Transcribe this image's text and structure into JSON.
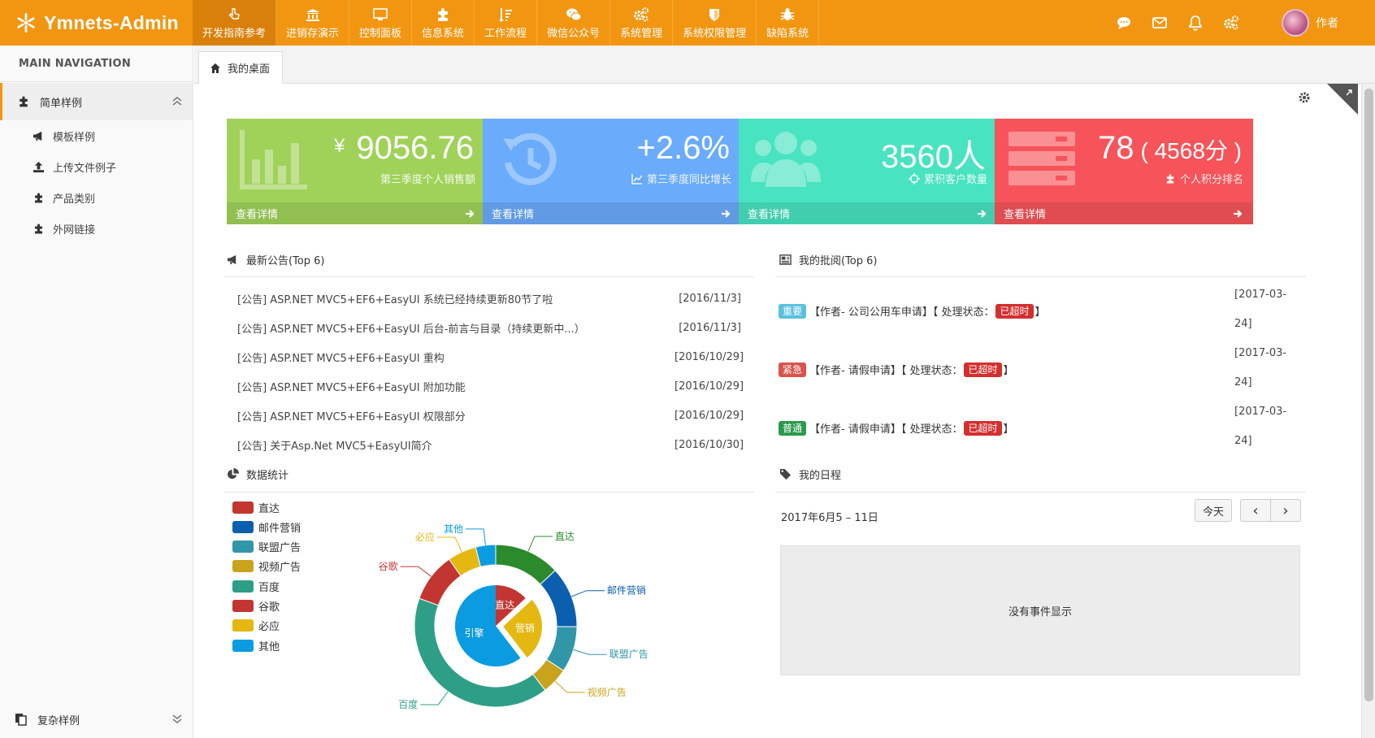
{
  "app": {
    "brand": "Ymnets-Admin",
    "user_name": "作者"
  },
  "topnav": [
    {
      "label": "开发指南参考",
      "icon": "pointer-hand-icon"
    },
    {
      "label": "进销存演示",
      "icon": "bank-icon"
    },
    {
      "label": "控制面板",
      "icon": "monitor-icon"
    },
    {
      "label": "信息系统",
      "icon": "puzzle-icon"
    },
    {
      "label": "工作流程",
      "icon": "sort-list-icon"
    },
    {
      "label": "微信公众号",
      "icon": "wechat-icon"
    },
    {
      "label": "系统管理",
      "icon": "gears-icon"
    },
    {
      "label": "系统权限管理",
      "icon": "shield-icon"
    },
    {
      "label": "缺陷系统",
      "icon": "bug-icon"
    }
  ],
  "sidebar": {
    "header": "MAIN NAVIGATION",
    "group1": "简单样例",
    "items": [
      {
        "label": "模板样例",
        "icon": "bullhorn-icon"
      },
      {
        "label": "上传文件例子",
        "icon": "upload-icon"
      },
      {
        "label": "产品类别",
        "icon": "puzzle-icon"
      },
      {
        "label": "外网链接",
        "icon": "puzzle-icon"
      }
    ],
    "group2": "复杂样例"
  },
  "tabs": {
    "home": "我的桌面"
  },
  "cards": [
    {
      "value": "9056.76",
      "prefix": "¥",
      "desc": "第三季度个人销售额",
      "foot": "查看详情",
      "color": "#a0d25a"
    },
    {
      "value": "+2.6%",
      "desc": "第三季度同比增长",
      "foot": "查看详情",
      "color": "#6aabfb"
    },
    {
      "value": "3560人",
      "desc": "累积客户数量",
      "foot": "查看详情",
      "color": "#48e3c0"
    },
    {
      "value": "78",
      "value_suffix": "( 4568分 )",
      "desc": "个人积分排名",
      "foot": "查看详情",
      "color": "#f6545a"
    }
  ],
  "announcements": {
    "title": "最新公告(Top 6)",
    "rows": [
      {
        "text": "[公告] ASP.NET MVC5+EF6+EasyUI 系统已经持续更新80节了啦",
        "date": "[2016/11/3]"
      },
      {
        "text": "[公告] ASP.NET MVC5+EF6+EasyUI 后台-前言与目录（持续更新中...）",
        "date": "[2016/11/3]"
      },
      {
        "text": "[公告] ASP.NET MVC5+EF6+EasyUI 重构",
        "date": "[2016/10/29]"
      },
      {
        "text": "[公告] ASP.NET MVC5+EF6+EasyUI 附加功能",
        "date": "[2016/10/29]"
      },
      {
        "text": "[公告] ASP.NET MVC5+EF6+EasyUI 权限部分",
        "date": "[2016/10/29]"
      },
      {
        "text": "[公告] 关于Asp.Net MVC5+EasyUI简介",
        "date": "[2016/10/30]"
      }
    ]
  },
  "approvals": {
    "title": "我的批阅(Top 6)",
    "rows": [
      {
        "badge": "重要",
        "badge_color": "#5bc0de",
        "text": "【作者- 公司公用车申请】【 处理状态：",
        "status": "已超时",
        "end": "】",
        "date1": "[2017-03-",
        "date2": "24]"
      },
      {
        "badge": "紧急",
        "badge_color": "#d9534f",
        "text": "【作者- 请假申请】【 处理状态：",
        "status": "已超时",
        "end": "】",
        "date1": "[2017-03-",
        "date2": "24]"
      },
      {
        "badge": "普通",
        "badge_color": "#2c9a4e",
        "text": "【作者- 请假申请】【 处理状态：",
        "status": "已超时",
        "end": "】",
        "date1": "[2017-03-",
        "date2": "24]"
      }
    ]
  },
  "stats": {
    "title": "数据统计"
  },
  "schedule": {
    "title": "我的日程",
    "range": "2017年6月5 – 11日",
    "today": "今天",
    "prev": "‹",
    "next": "›",
    "empty": "没有事件显示"
  },
  "chart_data": {
    "type": "pie",
    "legend_position": "left",
    "inner": {
      "labels": [
        "直达",
        "营销",
        "引擎"
      ],
      "values": [
        335,
        679,
        1548
      ],
      "colors": [
        "#c23531",
        "#e5b711",
        "#0b9be0"
      ]
    },
    "outer": {
      "labels": [
        "直达",
        "邮件营销",
        "联盟广告",
        "视频广告",
        "百度",
        "谷歌",
        "必应",
        "其他"
      ],
      "values": [
        335,
        310,
        234,
        135,
        1048,
        251,
        147,
        102
      ],
      "colors": [
        "#2b8a2b",
        "#0b5fae",
        "#3197a8",
        "#c9a31c",
        "#2e9f86",
        "#c23531",
        "#e5b711",
        "#0b9be0"
      ]
    },
    "legend": [
      {
        "label": "直达",
        "color": "#c23531"
      },
      {
        "label": "邮件营销",
        "color": "#0b5fae"
      },
      {
        "label": "联盟广告",
        "color": "#3197a8"
      },
      {
        "label": "视频广告",
        "color": "#c9a31c"
      },
      {
        "label": "百度",
        "color": "#2e9f86"
      },
      {
        "label": "谷歌",
        "color": "#c23531"
      },
      {
        "label": "必应",
        "color": "#e5b711"
      },
      {
        "label": "其他",
        "color": "#0b9be0"
      }
    ]
  }
}
